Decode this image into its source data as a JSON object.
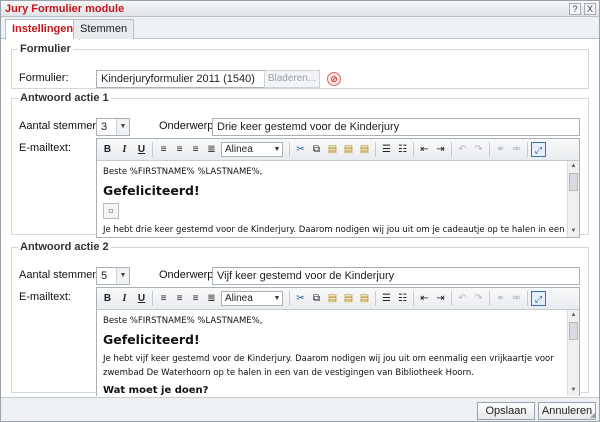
{
  "window": {
    "title": "Jury Formulier module",
    "help_label": "?",
    "close_label": "X"
  },
  "tabs": [
    {
      "label": "Instellingen",
      "active": true
    },
    {
      "label": "Stemmen",
      "active": false
    }
  ],
  "formulier": {
    "legend": "Formulier",
    "label": "Formulier:",
    "value": "Kinderjuryformulier 2011 (1540)",
    "browse_label": "Bladeren..."
  },
  "actie1": {
    "legend": "Antwoord actie 1",
    "stemmen_label": "Aantal stemmen:",
    "stemmen_value": "3",
    "onderwerp_label": "Onderwerp:",
    "onderwerp_value": "Drie keer gestemd voor de Kinderjury",
    "email_label": "E-mailtext:",
    "format_value": "Alinea",
    "body": {
      "greeting": "Beste %FIRSTNAME% %LASTNAME%,",
      "heading": "Gefeliciteerd!",
      "paragraph": "Je hebt drie keer gestemd voor de Kinderjury. Daarom nodigen wij jou uit om je cadeautje op te halen in een van de"
    }
  },
  "actie2": {
    "legend": "Antwoord actie 2",
    "stemmen_label": "Aantal stemmen:",
    "stemmen_value": "5",
    "onderwerp_label": "Onderwerp:",
    "onderwerp_value": "Vijf keer gestemd voor de Kinderjury",
    "email_label": "E-mailtext:",
    "format_value": "Alinea",
    "body": {
      "greeting": "Beste %FIRSTNAME% %LASTNAME%,",
      "heading": "Gefeliciteerd!",
      "paragraph": "Je hebt vijf keer gestemd voor de Kinderjury. Daarom nodigen wij jou uit om eenmalig een vrijkaartje voor zwembad De Waterhoorn op te halen in een van de vestigingen van Bibliotheek Hoorn.",
      "subheading": "Wat moet je doen?"
    }
  },
  "footer": {
    "save_label": "Opslaan",
    "cancel_label": "Annuleren"
  },
  "toolbar_icons": [
    "bold-icon",
    "italic-icon",
    "underline-icon",
    "align-left-icon",
    "align-center-icon",
    "align-right-icon",
    "align-justify-icon",
    "cut-icon",
    "copy-icon",
    "paste-icon",
    "paste-text-icon",
    "paste-word-icon",
    "bullet-list-icon",
    "numbered-list-icon",
    "outdent-icon",
    "indent-icon",
    "undo-icon",
    "redo-icon",
    "link-icon",
    "unlink-icon",
    "maximize-icon"
  ]
}
